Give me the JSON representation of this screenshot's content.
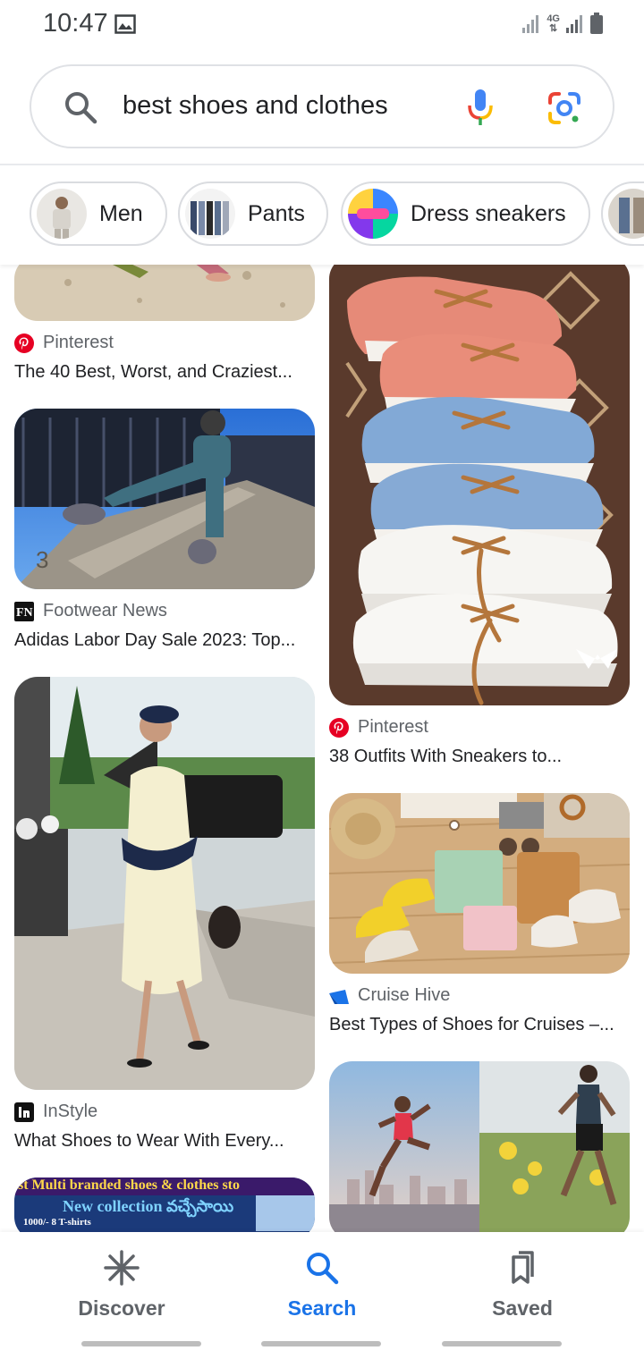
{
  "status_bar": {
    "time": "10:47",
    "network": "4G"
  },
  "search": {
    "query": "best shoes and clothes"
  },
  "chips": [
    {
      "label": "Men"
    },
    {
      "label": "Pants"
    },
    {
      "label": "Dress sneakers"
    }
  ],
  "left_column": [
    {
      "source": "Pinterest",
      "title": "The 40 Best, Worst, and Craziest..."
    },
    {
      "source": "Footwear News",
      "title": "Adidas Labor Day Sale 2023: Top..."
    },
    {
      "source": "InStyle",
      "title": "What Shoes to Wear With Every..."
    },
    {
      "banner_line1": "st Multi branded shoes & clothes sto",
      "banner_line2": "New collection వచ్చేసాయి",
      "banner_line3": "1000/-  8 T-shirts"
    }
  ],
  "right_column": [
    {
      "source": "Pinterest",
      "title": "38 Outfits With Sneakers to..."
    },
    {
      "source": "Cruise Hive",
      "title": "Best Types of Shoes for Cruises –..."
    }
  ],
  "bottom_nav": [
    {
      "label": "Discover"
    },
    {
      "label": "Search"
    },
    {
      "label": "Saved"
    }
  ],
  "colors": {
    "accent": "#1a73e8",
    "pinterest_red": "#e60023"
  }
}
